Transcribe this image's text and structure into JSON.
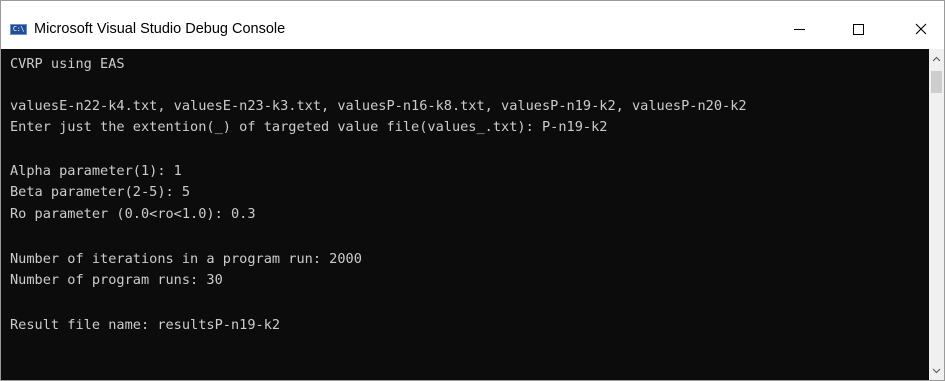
{
  "window": {
    "icon_text": "C:\\",
    "title": "Microsoft Visual Studio Debug Console"
  },
  "controls": {
    "minimize_icon": "minimize-icon",
    "maximize_icon": "maximize-icon",
    "close_icon": "close-icon",
    "close_glyph": "✕"
  },
  "console": {
    "lines": [
      "CVRP using EAS",
      "valuesE-n22-k4.txt, valuesE-n23-k3.txt, valuesP-n16-k8.txt, valuesP-n19-k2, valuesP-n20-k2",
      "Enter just the extention(_) of targeted value file(values_.txt): P-n19-k2",
      "Alpha parameter(1): 1",
      "Beta parameter(2-5): 5",
      "Ro parameter (0.0<ro<1.0): 0.3",
      "Number of iterations in a program run: 2000",
      "Number of program runs: 30",
      "Result file name: resultsP-n19-k2"
    ]
  },
  "scrollbar": {
    "up_arrow": "chevron-up-icon",
    "down_arrow": "chevron-down-icon"
  },
  "colors": {
    "console_bg": "#0c0c0c",
    "console_text": "#cccccc"
  }
}
